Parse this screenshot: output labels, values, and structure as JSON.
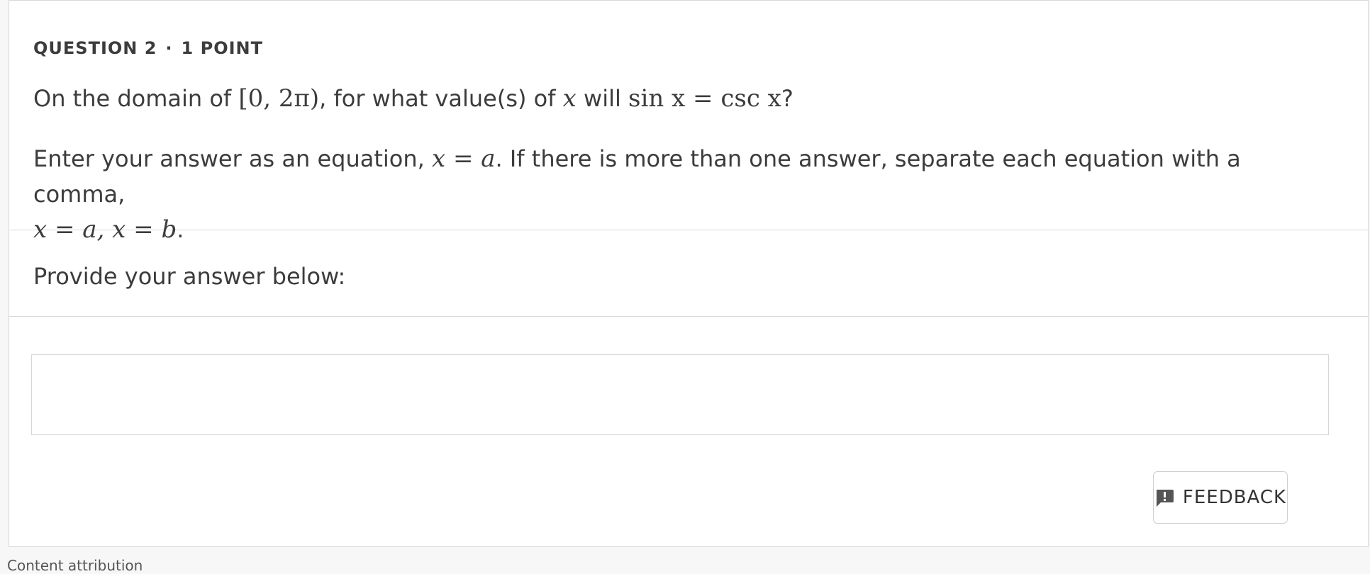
{
  "question": {
    "number_label": "QUESTION 2",
    "separator": "·",
    "points_label": "1 POINT",
    "text_prefix": "On the domain of ",
    "domain_math": "[0, 2π)",
    "text_mid": ", for what value(s) of ",
    "var_x": "x",
    "text_will": " will ",
    "equation_math": "sin x = csc x",
    "text_end": "?",
    "instruction_prefix": "Enter your answer as an equation, ",
    "instruction_eq1": "x = a",
    "instruction_mid": ". If there is more than one answer, separate each equation with a comma,",
    "instruction_eq2": "x = a, x = b",
    "instruction_end": "."
  },
  "answer": {
    "prompt": "Provide your answer below:",
    "value": "",
    "placeholder": ""
  },
  "feedback": {
    "label": "FEEDBACK",
    "icon": "feedback-icon",
    "icon_color": "#555555"
  },
  "footer": {
    "attribution_label": "Content attribution"
  }
}
